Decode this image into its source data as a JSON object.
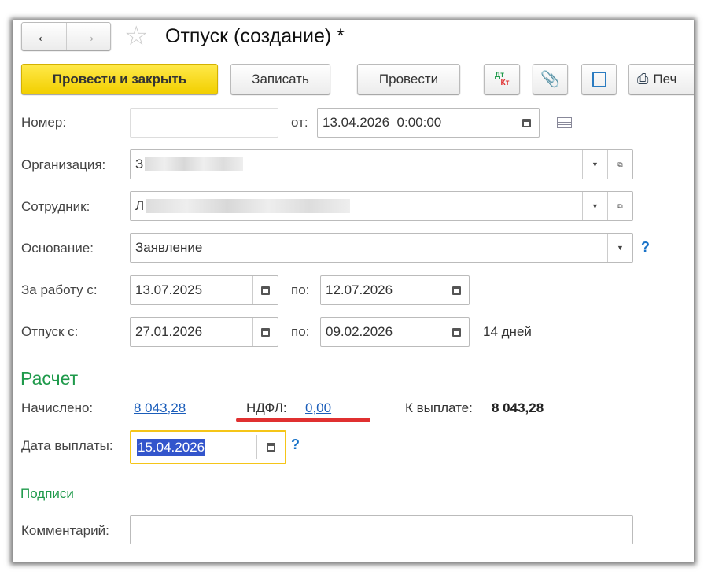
{
  "window": {
    "title": "Отпуск (создание) *"
  },
  "nav": {
    "back_icon": "arrow-left-icon",
    "forward_icon": "arrow-right-icon",
    "favorite_icon": "star-icon"
  },
  "toolbar": {
    "post_close": "Провести и закрыть",
    "save": "Записать",
    "post": "Провести",
    "dtkt_dt": "Дт",
    "dtkt_kt": "Кт",
    "print": "Печ"
  },
  "form": {
    "number_label": "Номер:",
    "number_value": "",
    "from_label": "от:",
    "date_value": "13.04.2026  0:00:00",
    "org_label": "Организация:",
    "org_prefix": "З",
    "employee_label": "Сотрудник:",
    "employee_prefix": "Л",
    "basis_label": "Основание:",
    "basis_value": "Заявление",
    "help": "?",
    "work_from_label": "За работу с:",
    "work_from": "13.07.2025",
    "to_label": "по:",
    "work_to": "12.07.2026",
    "vac_from_label": "Отпуск с:",
    "vac_from": "27.01.2026",
    "vac_to": "09.02.2026",
    "days": "14 дней"
  },
  "calc": {
    "title": "Расчет",
    "accrued_label": "Начислено:",
    "accrued": "8 043,28",
    "ndfl_label": "НДФЛ:",
    "ndfl": "0,00",
    "pay_label": "К выплате:",
    "pay": "8 043,28",
    "pay_date_label": "Дата выплаты:",
    "pay_date": "15.04.2026"
  },
  "signatures": "Подписи",
  "comment_label": "Комментарий:",
  "comment_value": "",
  "colors": {
    "accent_yellow": "#f2cf00",
    "green": "#1f9a4b",
    "link": "#1a5dba",
    "highlight": "#3355cc",
    "underline_red": "#e03030"
  }
}
